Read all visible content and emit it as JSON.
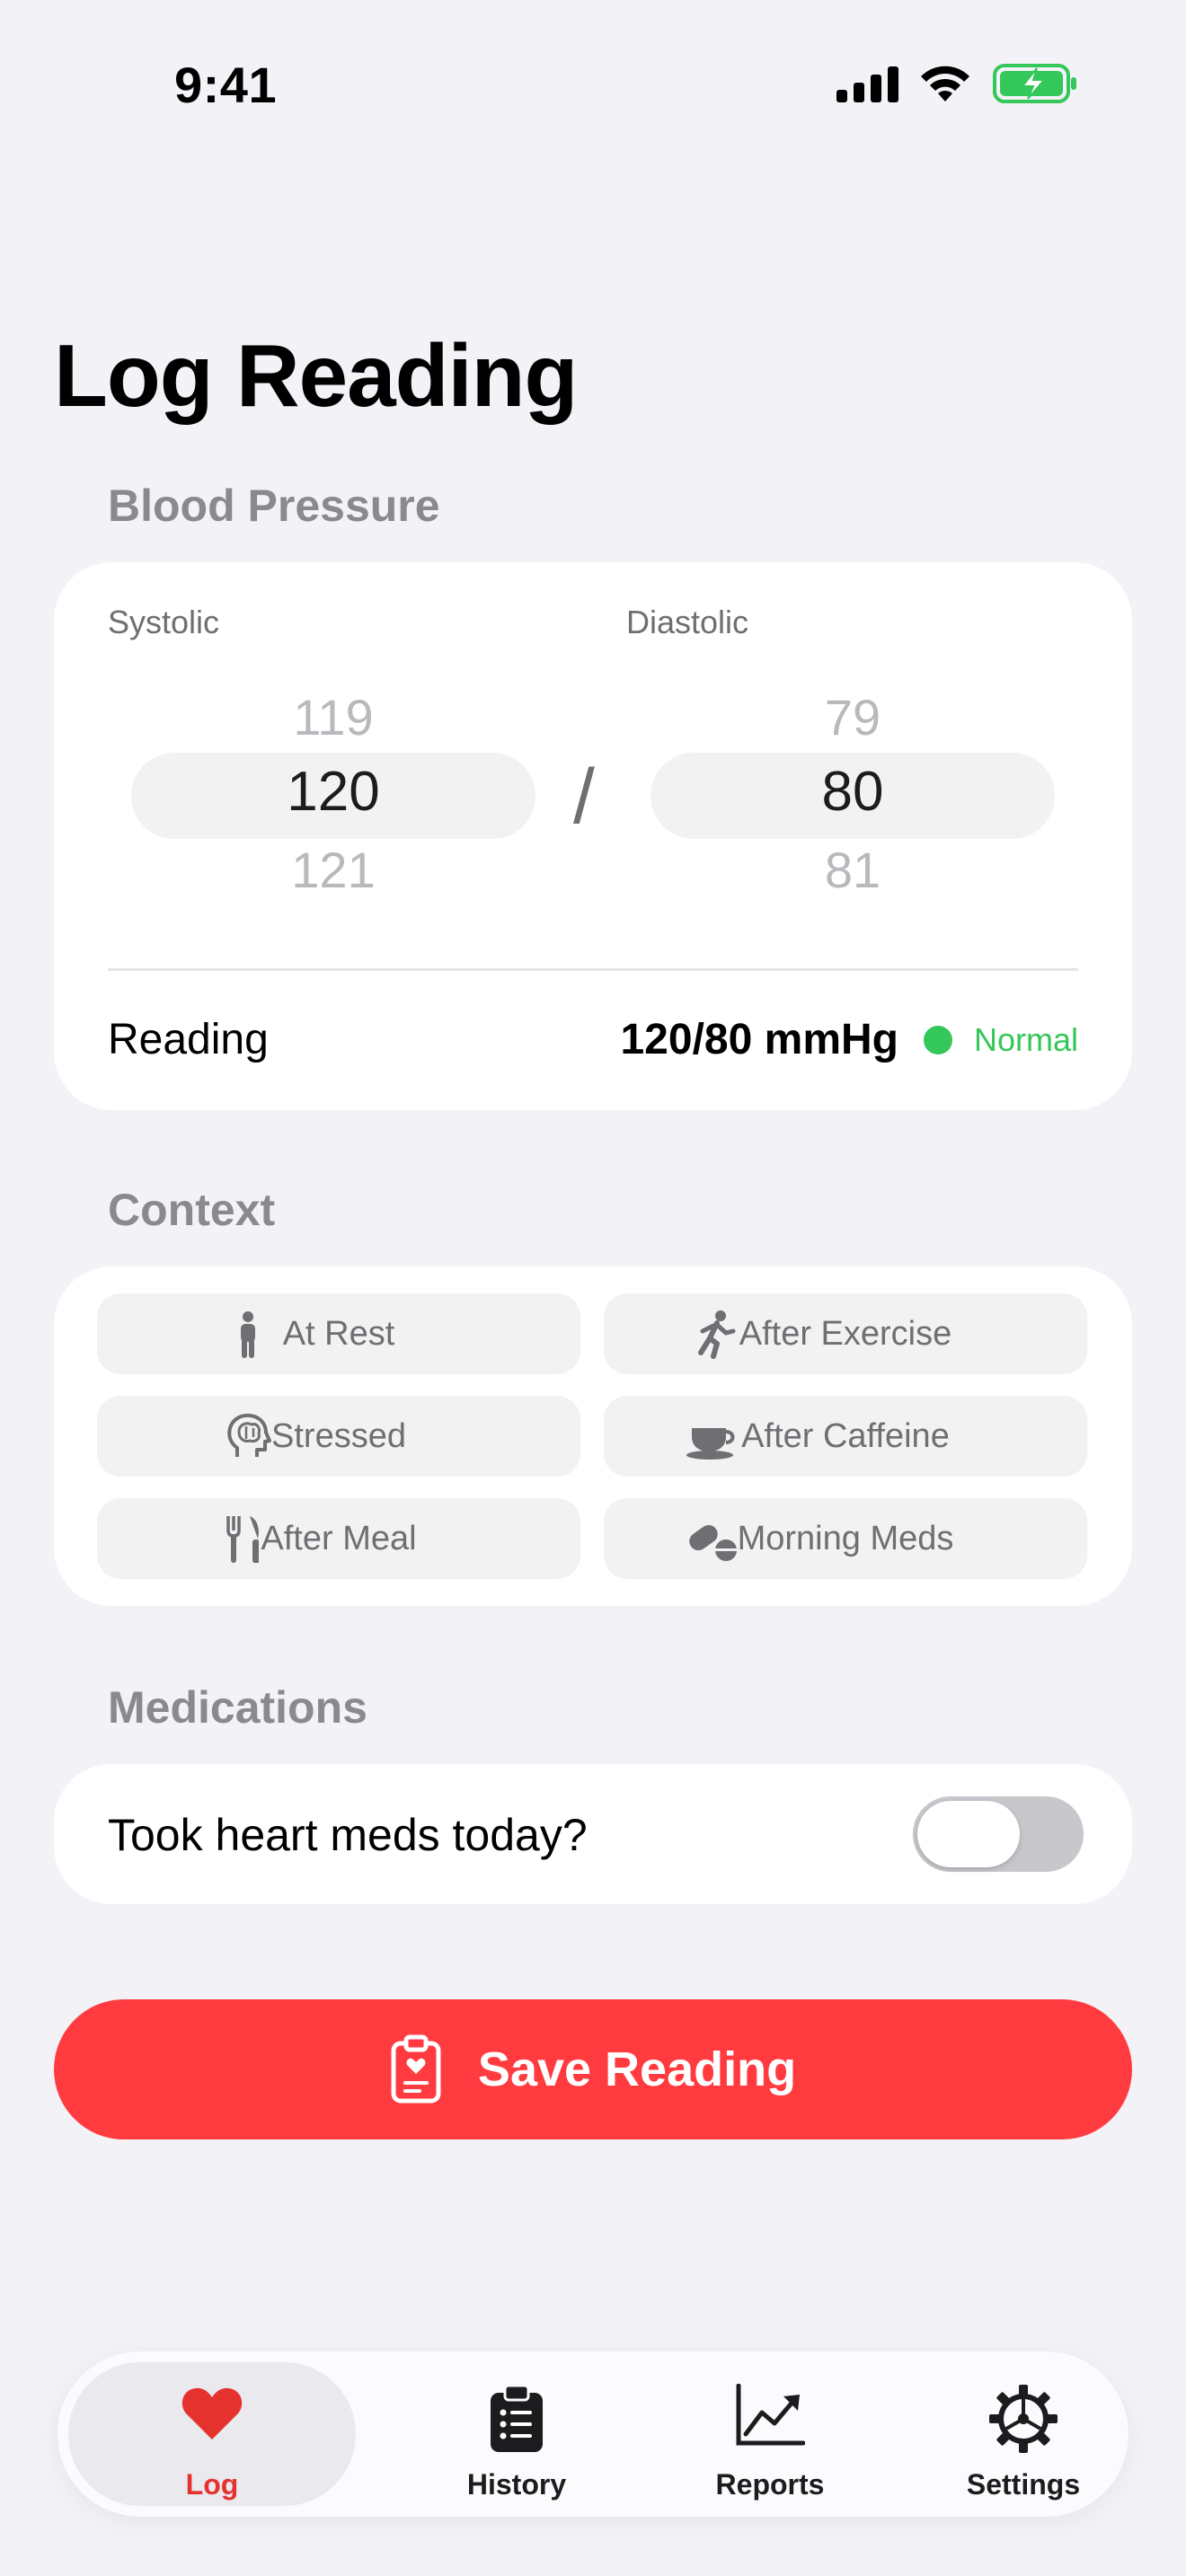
{
  "status_bar": {
    "time": "9:41"
  },
  "title": "Log Reading",
  "blood_pressure": {
    "section_label": "Blood Pressure",
    "systolic": {
      "label": "Systolic",
      "above": "119",
      "current": "120",
      "below": "121"
    },
    "diastolic": {
      "label": "Diastolic",
      "above": "79",
      "current": "80",
      "below": "81"
    },
    "separator": "/",
    "reading_label": "Reading",
    "reading_value": "120/80 mmHg",
    "status": "Normal",
    "status_color": "#34c759"
  },
  "context": {
    "section_label": "Context",
    "options": [
      {
        "label": "At Rest",
        "icon": "person-standing-icon"
      },
      {
        "label": "After Exercise",
        "icon": "running-icon"
      },
      {
        "label": "Stressed",
        "icon": "brain-head-icon"
      },
      {
        "label": "After Caffeine",
        "icon": "coffee-cup-icon"
      },
      {
        "label": "After Meal",
        "icon": "fork-knife-icon"
      },
      {
        "label": "Morning Meds",
        "icon": "pills-icon"
      }
    ]
  },
  "medications": {
    "section_label": "Medications",
    "toggle_label": "Took heart meds today?",
    "toggle_on": false
  },
  "save_button": {
    "label": "Save Reading",
    "icon": "clipboard-heart-icon",
    "color": "#ff3b40"
  },
  "tabs": [
    {
      "label": "Log",
      "icon": "heart-icon",
      "active": true
    },
    {
      "label": "History",
      "icon": "clipboard-list-icon",
      "active": false
    },
    {
      "label": "Reports",
      "icon": "chart-line-icon",
      "active": false
    },
    {
      "label": "Settings",
      "icon": "gear-icon",
      "active": false
    }
  ]
}
